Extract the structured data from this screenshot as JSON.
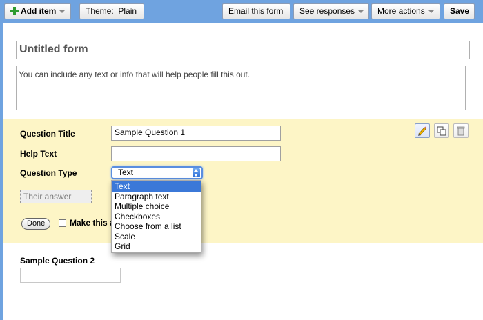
{
  "toolbar": {
    "add_item_label": "Add item",
    "theme_label": "Theme:",
    "theme_value": "Plain",
    "email_label": "Email this form",
    "responses_label": "See responses",
    "more_actions_label": "More actions",
    "save_label": "Save"
  },
  "form": {
    "title": "Untitled form",
    "description": "You can include any text or info that will help people fill this out."
  },
  "question_editor": {
    "title_label": "Question Title",
    "title_value": "Sample Question 1",
    "help_label": "Help Text",
    "help_value": "",
    "type_label": "Question Type",
    "type_selected": "Text",
    "type_options": [
      "Text",
      "Paragraph text",
      "Multiple choice",
      "Checkboxes",
      "Choose from a list",
      "Scale",
      "Grid"
    ],
    "answer_placeholder": "Their answer",
    "done_label": "Done",
    "required_label": "Make this a required question",
    "required_checked": false
  },
  "question2": {
    "title": "Sample Question 2"
  },
  "icons": {
    "add": "plus-icon",
    "edit": "pencil-icon",
    "duplicate": "duplicate-icon",
    "delete": "trash-icon"
  },
  "colors": {
    "toolbar_bg": "#6fa3e0",
    "editor_bg": "#fdf5c6",
    "selected_option": "#3b78d8",
    "add_icon": "#2e9b2e"
  }
}
